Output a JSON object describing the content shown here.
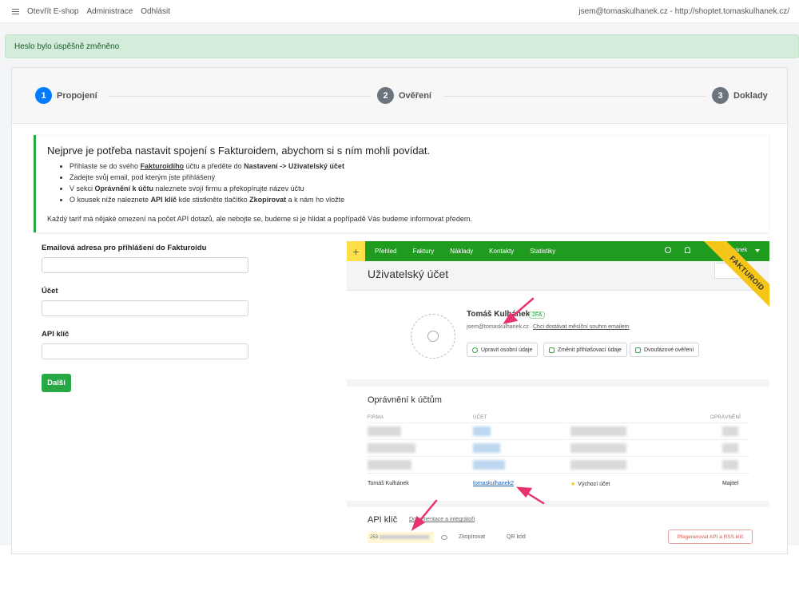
{
  "topbar": {
    "links": [
      "Otevřít E-shop",
      "Administrace",
      "Odhlásit"
    ],
    "account": "jsem@tomaskulhanek.cz - http://shoptet.tomaskulhanek.cz/"
  },
  "alert": {
    "text": "Heslo bylo úspěšně změněno"
  },
  "steps": [
    {
      "num": "1",
      "label": "Propojení"
    },
    {
      "num": "2",
      "label": "Ověření"
    },
    {
      "num": "3",
      "label": "Doklady"
    }
  ],
  "info": {
    "heading": "Nejprve je potřeba nastavit spojení s Fakturoidem, abychom si s ním mohli povídat.",
    "b1_pre": "Přihlaste se do svého ",
    "b1_link": "Fakturoidího",
    "b1_mid": " účtu a předěte do ",
    "b1_bold": "Nastavení -> Uživatelský účet",
    "b2": "Zadejte svůj email, pod kterým jste přihlášený",
    "b3_pre": "V sekci ",
    "b3_bold": "Oprávnění k účtu",
    "b3_post": " naleznete svojí firmu a překopírujte název účtu",
    "b4_pre": "O kousek níže naleznete ",
    "b4_bold1": "API klíč",
    "b4_mid": " kde stistkněte tlačítko ",
    "b4_bold2": "Zkopírovat",
    "b4_post": " a k nám ho vložte",
    "note": "Každý tarif má nějaké omezení na počet API dotazů, ale nebojte se, budeme si je hlídat a popřípadě Vás budeme informovat předem."
  },
  "form": {
    "email_label": "Emailová adresa pro přihlášení do Fakturoidu",
    "account_label": "Účet",
    "api_label": "API klíč",
    "submit": "Další"
  },
  "shot": {
    "nav": [
      "Přehled",
      "Faktury",
      "Náklady",
      "Kontakty",
      "Statistiky"
    ],
    "user": "Kulhánek",
    "ribbon": "FAKTUROID",
    "title": "Uživatelský účet",
    "name": "Tomáš Kulhánek",
    "badge": "2FA",
    "email": "jsem@tomaskulhanek.cz",
    "sep": "·",
    "email_link": "Chci dostávat měsíční souhrn emailem",
    "btn_edit": "Upravit osobní údaje",
    "btn_login": "Změnit přihlašovací údaje",
    "btn_2fa": "Dvoufázové ověření",
    "perm_title": "Oprávnění k účtům",
    "col_firm": "FIRMA",
    "col_account": "ÚČET",
    "col_right": "OPRÁVNĚNÍ",
    "row_firm": "Tomáš Kulhánek",
    "row_account": "tomaskulhanek2",
    "row_default": "Výchozí účet",
    "row_role": "Majitel",
    "api_title": "API klíč",
    "api_doc": "Dokumentace a integrátoři",
    "api_prefix": "253",
    "copy": "Zkopírovat",
    "qr": "QR kód",
    "regen": "Přegenerovat API a RSS klíč"
  }
}
